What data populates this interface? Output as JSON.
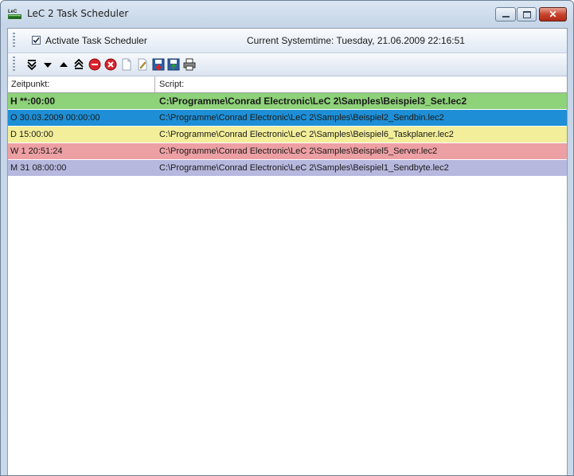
{
  "window": {
    "title": "LeC 2 Task Scheduler",
    "close_label": "✕"
  },
  "toolbar": {
    "activate_label": "Activate Task Scheduler",
    "activate_checked": true,
    "systemtime": "Current Systemtime: Tuesday, 21.06.2009 22:16:51"
  },
  "icons": [
    "move-bottom-icon",
    "move-down-icon",
    "move-up-icon",
    "move-top-icon",
    "stop-icon",
    "delete-icon",
    "new-icon",
    "edit-icon",
    "open-icon",
    "save-icon",
    "print-icon"
  ],
  "table": {
    "columns": [
      "Zeitpunkt:",
      "Script:"
    ],
    "rows": [
      {
        "time": "H **:00:00",
        "script": "C:\\Programme\\Conrad Electronic\\LeC 2\\Samples\\Beispiel3_Set.lec2",
        "color": "#8ed27a"
      },
      {
        "time": "O 30.03.2009 00:00:00",
        "script": "C:\\Programme\\Conrad Electronic\\LeC 2\\Samples\\Beispiel2_Sendbin.lec2",
        "color": "#1e8fd6"
      },
      {
        "time": "D 15:00:00",
        "script": "C:\\Programme\\Conrad Electronic\\LeC 2\\Samples\\Beispiel6_Taskplaner.lec2",
        "color": "#f3ee9a"
      },
      {
        "time": "W 1 20:51:24",
        "script": "C:\\Programme\\Conrad Electronic\\LeC 2\\Samples\\Beispiel5_Server.lec2",
        "color": "#eda0a4"
      },
      {
        "time": "M 31 08:00:00",
        "script": "C:\\Programme\\Conrad Electronic\\LeC 2\\Samples\\Beispiel1_Sendbyte.lec2",
        "color": "#b7b8de"
      }
    ]
  }
}
